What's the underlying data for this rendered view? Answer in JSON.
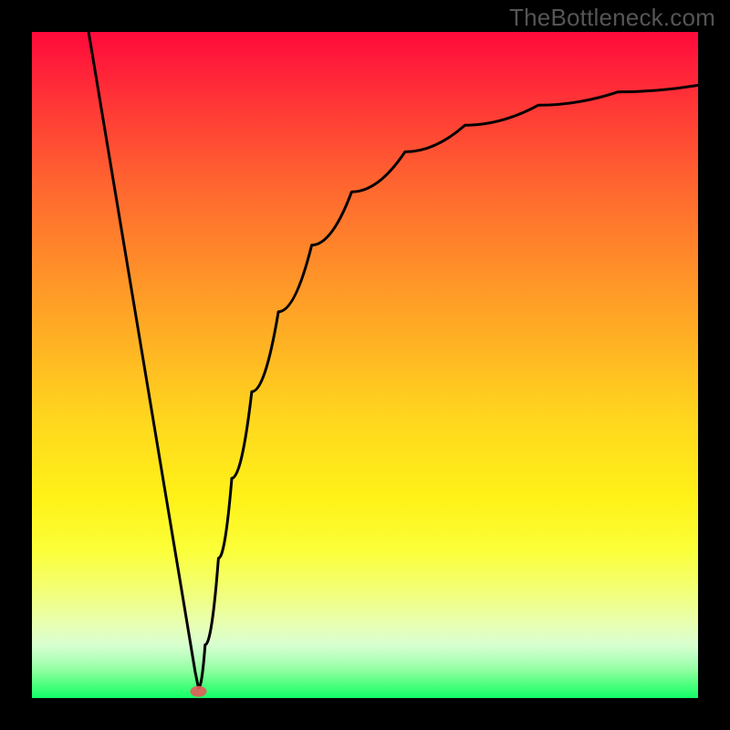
{
  "watermark": "TheBottleneck.com",
  "chart_data": {
    "type": "line",
    "title": "",
    "xlabel": "",
    "ylabel": "",
    "xlim": [
      0,
      1
    ],
    "ylim": [
      0,
      1
    ],
    "note": "Axes are unlabeled; values are normalized 0–1 read off the plotted curve. Curve depicts a V-profile: steep linear descent to a minimum near x≈0.25, then an asymptotically-flattening rise toward the right edge.",
    "minimum": {
      "x": 0.25,
      "y": 0.015
    },
    "marker": {
      "x": 0.25,
      "y": 0.01,
      "color": "#e45a5a"
    },
    "series": [
      {
        "name": "left-branch",
        "x": [
          0.085,
          0.11,
          0.14,
          0.17,
          0.2,
          0.225,
          0.245,
          0.25
        ],
        "y": [
          1.0,
          0.85,
          0.67,
          0.49,
          0.31,
          0.16,
          0.04,
          0.015
        ]
      },
      {
        "name": "right-branch",
        "x": [
          0.25,
          0.26,
          0.28,
          0.3,
          0.33,
          0.37,
          0.42,
          0.48,
          0.56,
          0.65,
          0.76,
          0.88,
          1.0
        ],
        "y": [
          0.015,
          0.08,
          0.21,
          0.33,
          0.46,
          0.58,
          0.68,
          0.76,
          0.82,
          0.86,
          0.89,
          0.91,
          0.92
        ]
      }
    ],
    "background_gradient": {
      "orientation": "vertical",
      "stops": [
        {
          "pos": 0.0,
          "color": "#ff0a3a"
        },
        {
          "pos": 0.35,
          "color": "#ff8a2a"
        },
        {
          "pos": 0.7,
          "color": "#fff218"
        },
        {
          "pos": 0.9,
          "color": "#e8ffb4"
        },
        {
          "pos": 1.0,
          "color": "#12ff68"
        }
      ]
    }
  }
}
